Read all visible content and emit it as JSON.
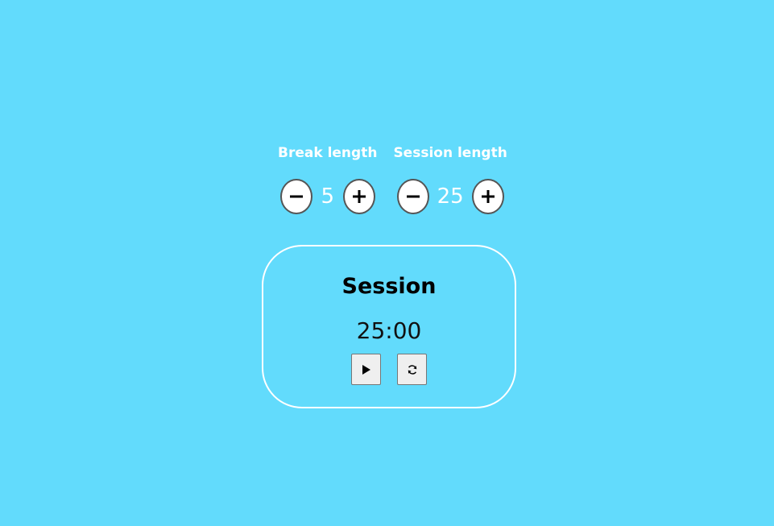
{
  "break": {
    "label": "Break length",
    "value": "5",
    "decrement_icon": "minus-icon",
    "increment_icon": "plus-icon"
  },
  "session": {
    "label": "Session length",
    "value": "25",
    "decrement_icon": "minus-icon",
    "increment_icon": "plus-icon"
  },
  "timer": {
    "label": "Session",
    "time_left": "25:00",
    "start_icon": "play-icon",
    "reset_icon": "refresh-icon"
  },
  "colors": {
    "background": "#62dbfc",
    "text_light": "#ffffff",
    "text_dark": "#000000",
    "border": "#ffffff"
  }
}
